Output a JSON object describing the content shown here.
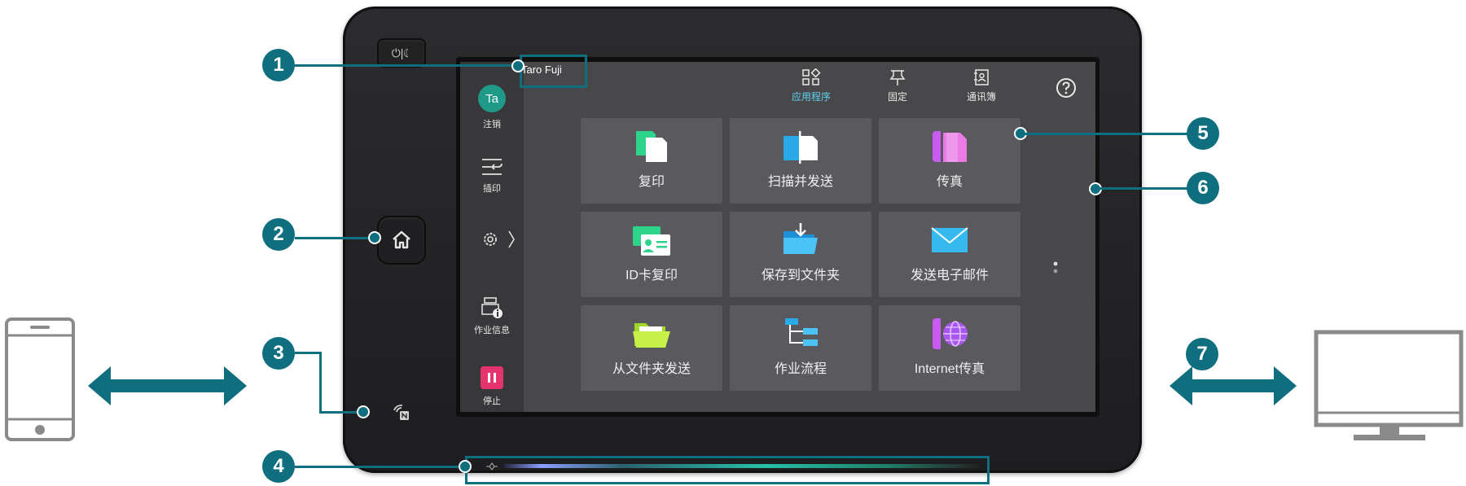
{
  "device": {
    "power_label": "⏻|☾",
    "user": {
      "name": "Taro Fuji",
      "initials": "Ta",
      "logout_label": "注销"
    },
    "sidebar": {
      "interrupt_label": "插印",
      "job_info_label": "作业信息",
      "stop_label": "停止"
    },
    "topnav": {
      "apps_label": "应用程序",
      "pin_label": "固定",
      "address_book_label": "通讯簿"
    },
    "tiles": [
      {
        "label": "复印",
        "icon": "copy-icon"
      },
      {
        "label": "扫描并发送",
        "icon": "scan-icon"
      },
      {
        "label": "传真",
        "icon": "fax-icon"
      },
      {
        "label": "ID卡复印",
        "icon": "id-card-icon"
      },
      {
        "label": "保存到文件夹",
        "icon": "save-folder-icon"
      },
      {
        "label": "发送电子邮件",
        "icon": "email-icon"
      },
      {
        "label": "从文件夹发送",
        "icon": "open-folder-icon"
      },
      {
        "label": "作业流程",
        "icon": "workflow-icon"
      },
      {
        "label": "Internet传真",
        "icon": "internet-fax-icon"
      }
    ]
  },
  "callouts": [
    "1",
    "2",
    "3",
    "4",
    "5",
    "6",
    "7"
  ],
  "colors": {
    "accent": "#0f6f7e",
    "screen": "#48484b",
    "tile": "#5a5a5e",
    "avatar": "#1f9a88",
    "stop": "#e5336d",
    "active_nav": "#5fd3f0"
  }
}
